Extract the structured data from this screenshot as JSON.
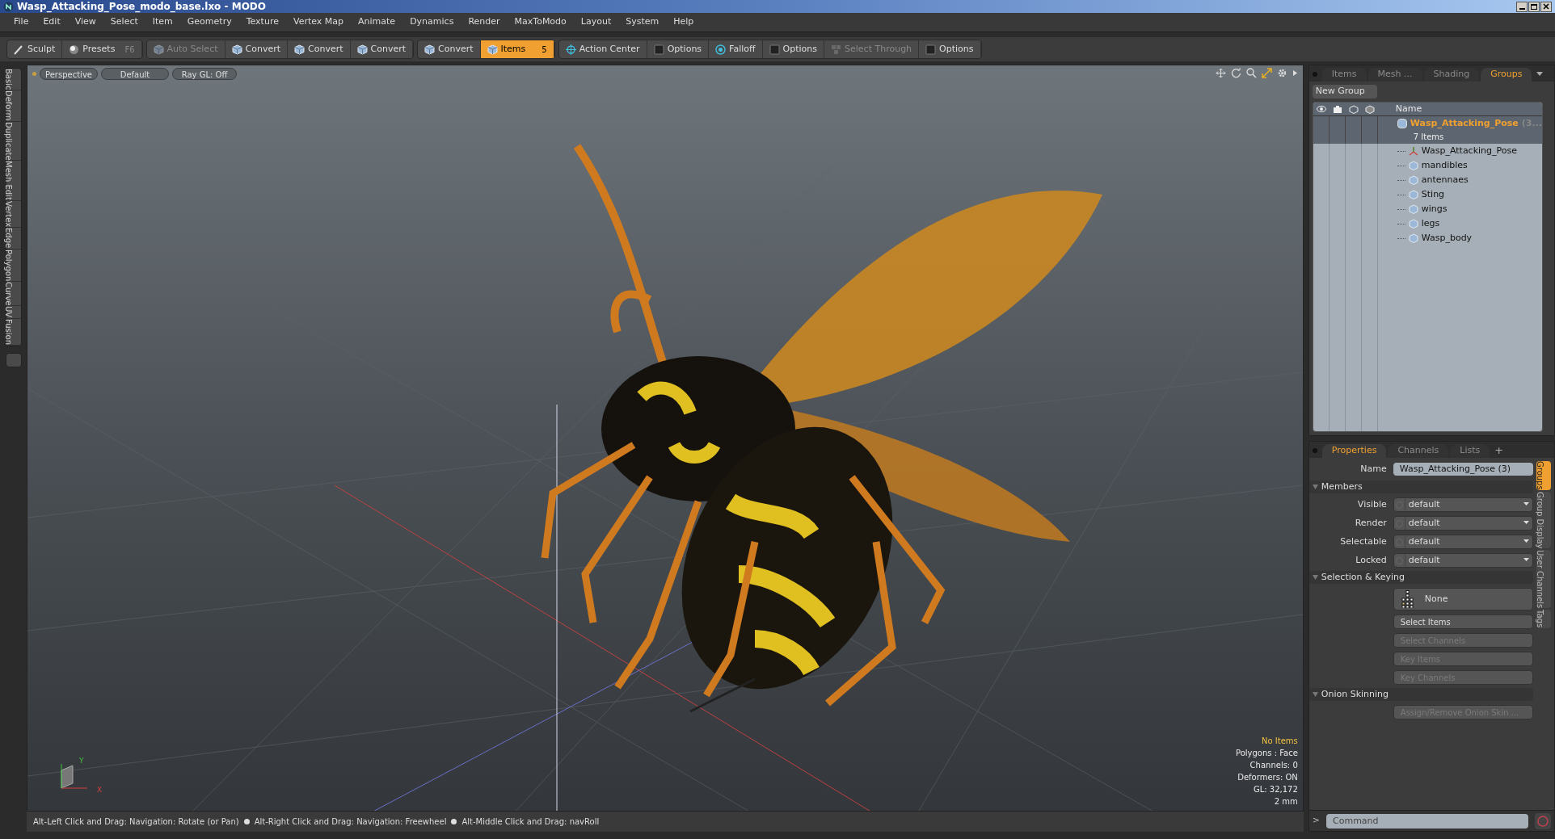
{
  "window": {
    "title": "Wasp_Attacking_Pose_modo_base.lxo - MODO"
  },
  "menu": [
    "File",
    "Edit",
    "View",
    "Select",
    "Item",
    "Geometry",
    "Texture",
    "Vertex Map",
    "Animate",
    "Dynamics",
    "Render",
    "MaxToModo",
    "Layout",
    "System",
    "Help"
  ],
  "toolbar": [
    {
      "kind": "tool",
      "label": "Sculpt",
      "disabled": false
    },
    {
      "kind": "tool",
      "label": "Presets",
      "shortcut": "F6",
      "disabled": false
    },
    {
      "kind": "tool",
      "label": "Auto Select",
      "disabled": true
    },
    {
      "kind": "tool",
      "label": "Convert",
      "disabled": false
    },
    {
      "kind": "tool",
      "label": "Convert",
      "disabled": false
    },
    {
      "kind": "tool",
      "label": "Convert",
      "disabled": false
    },
    {
      "kind": "tool",
      "label": "Convert",
      "disabled": false
    },
    {
      "kind": "toggle",
      "label": "Items",
      "badge": "5",
      "selected": true
    },
    {
      "kind": "tool",
      "label": "Action Center",
      "disabled": false
    },
    {
      "kind": "tool",
      "label": "Options",
      "disabled": false
    },
    {
      "kind": "tool",
      "label": "Falloff",
      "disabled": false
    },
    {
      "kind": "tool",
      "label": "Options",
      "disabled": false
    },
    {
      "kind": "tool",
      "label": "Select Through",
      "disabled": true
    },
    {
      "kind": "tool",
      "label": "Options",
      "disabled": false
    }
  ],
  "left_tabs": [
    "Basic",
    "Deform",
    "Duplicate",
    "Mesh Edit",
    "Vertex",
    "Edge",
    "Polygon",
    "Curve",
    "UV",
    "Fusion"
  ],
  "viewport": {
    "buttons": [
      "Perspective",
      "Default",
      "Ray GL: Off"
    ],
    "info": [
      {
        "text": "No Items",
        "highlight": true
      },
      {
        "text": "Polygons : Face",
        "highlight": false
      },
      {
        "text": "Channels: 0",
        "highlight": false
      },
      {
        "text": "Deformers: ON",
        "highlight": false
      },
      {
        "text": "GL: 32,172",
        "highlight": false
      },
      {
        "text": "2 mm",
        "highlight": false
      }
    ],
    "axis_labels": [
      "Y",
      "X"
    ]
  },
  "groups_panel": {
    "tabs": [
      {
        "label": "Items",
        "selected": false
      },
      {
        "label": "Mesh ...",
        "selected": false
      },
      {
        "label": "Shading",
        "selected": false
      },
      {
        "label": "Groups",
        "selected": true
      }
    ],
    "new_group": "New Group",
    "column": "Name",
    "group": {
      "name": "Wasp_Attacking_Pose",
      "suffix": "(3...",
      "count": "7 Items",
      "children": [
        {
          "kind": "locator",
          "name": "Wasp_Attacking_Pose"
        },
        {
          "kind": "mesh",
          "name": "mandibles"
        },
        {
          "kind": "mesh",
          "name": "antennaes"
        },
        {
          "kind": "mesh",
          "name": "Sting"
        },
        {
          "kind": "mesh",
          "name": "wings"
        },
        {
          "kind": "mesh",
          "name": "legs"
        },
        {
          "kind": "mesh",
          "name": "Wasp_body"
        }
      ]
    }
  },
  "properties_panel": {
    "tabs": [
      {
        "label": "Properties",
        "selected": true
      },
      {
        "label": "Channels",
        "selected": false
      },
      {
        "label": "Lists",
        "selected": false
      }
    ],
    "add_tab": "+",
    "name_label": "Name",
    "name_value": "Wasp_Attacking_Pose (3)",
    "sections": [
      {
        "title": "Members",
        "rows": [
          {
            "kind": "dropdown",
            "label": "Visible",
            "value": "default"
          },
          {
            "kind": "dropdown",
            "label": "Render",
            "value": "default"
          },
          {
            "kind": "dropdown",
            "label": "Selectable",
            "value": "default"
          },
          {
            "kind": "dropdown",
            "label": "Locked",
            "value": "default"
          }
        ]
      },
      {
        "title": "Selection & Keying",
        "rows": [
          {
            "kind": "preset",
            "label": "None"
          },
          {
            "kind": "button",
            "label": "Select Items",
            "disabled": false
          },
          {
            "kind": "button",
            "label": "Select Channels",
            "disabled": true
          },
          {
            "kind": "button",
            "label": "Key Items",
            "disabled": true
          },
          {
            "kind": "button",
            "label": "Key Channels",
            "disabled": true
          }
        ]
      },
      {
        "title": "Onion Skinning",
        "rows": [
          {
            "kind": "button",
            "label": "Assign/Remove Onion Skin ...",
            "disabled": true
          }
        ]
      }
    ],
    "side_tabs": [
      {
        "label": "Groups",
        "selected": true
      },
      {
        "label": "Group Display",
        "selected": false
      },
      {
        "label": "User Channels",
        "selected": false
      },
      {
        "label": "Tags",
        "selected": false
      }
    ]
  },
  "command": {
    "prompt": ">",
    "placeholder": "Command"
  },
  "status_bar": [
    "Alt-Left Click and Drag: Navigation: Rotate (or Pan)",
    "Alt-Right Click and Drag: Navigation: Freewheel",
    "Alt-Middle Click and Drag: navRoll"
  ]
}
